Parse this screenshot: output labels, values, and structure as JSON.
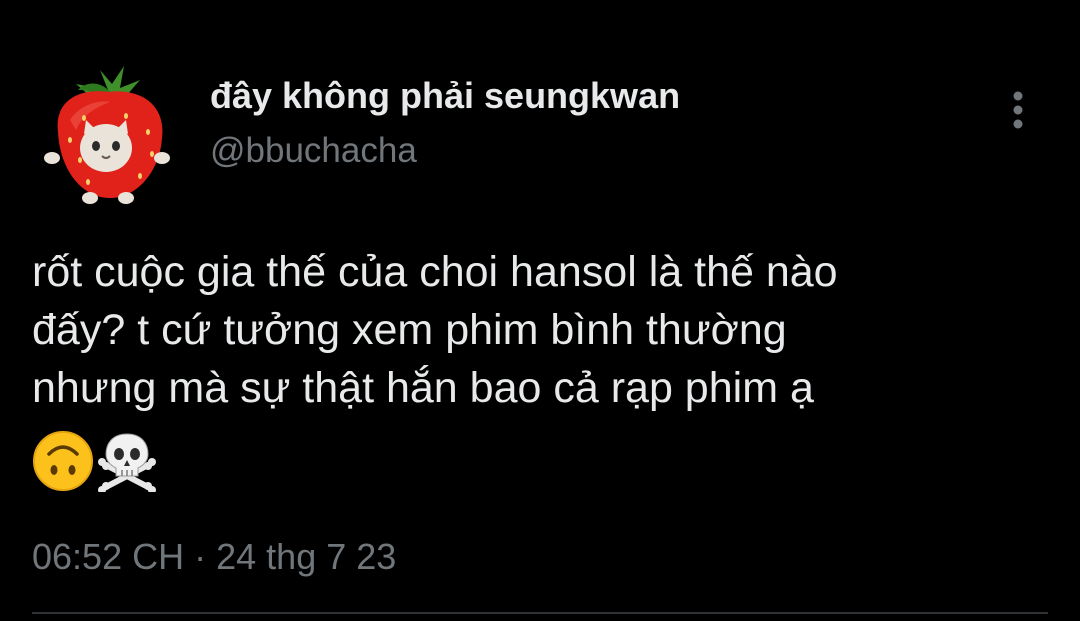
{
  "tweet": {
    "author": {
      "display_name": "đây không phải seungkwan",
      "handle": "@bbuchacha",
      "avatar_icon": "strawberry-cat-avatar"
    },
    "text": "rốt cuộc gia thế của choi hansol là thế nào\nđấy? t cứ tưởng xem phim bình thường\nnhưng mà sự thật hắn bao cả rạp phim ạ",
    "emojis": [
      "upside-down-face-emoji",
      "skull-and-crossbones-emoji"
    ],
    "time": "06:52 CH",
    "separator": "·",
    "date": "24 thg 7 23",
    "more_icon": "more-vertical-icon"
  },
  "colors": {
    "background": "#000000",
    "primary_text": "#e7e9ea",
    "secondary_text": "#71767b",
    "divider": "#2f3336"
  }
}
